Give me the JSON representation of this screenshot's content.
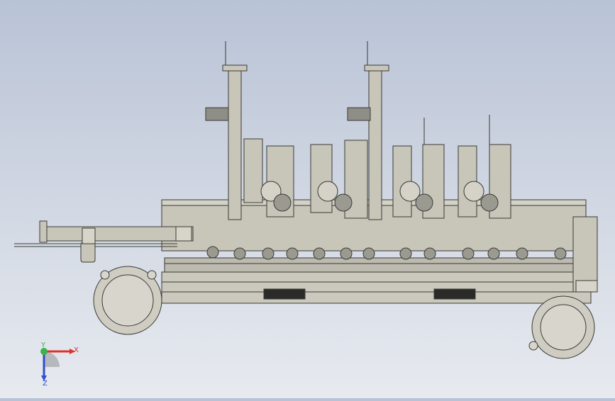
{
  "viewport": {
    "axis_triad": {
      "x_label": "X",
      "y_label": "Y",
      "z_label": "Z",
      "x_color": "#e0302a",
      "y_color": "#3bb24a",
      "z_color": "#2f4fd0"
    },
    "model_colors": {
      "body": "#c8c6b9",
      "stroke": "#3a3a36",
      "dark": "#2a2a28",
      "wheel": "#cfcdc2"
    }
  }
}
